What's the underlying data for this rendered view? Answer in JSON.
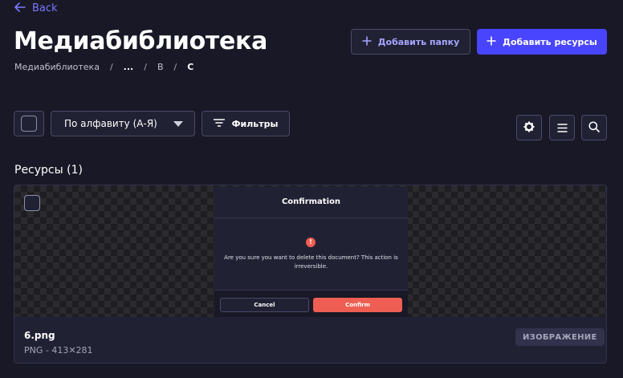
{
  "nav": {
    "back_label": "Back"
  },
  "header": {
    "title": "Медиабиблиотека",
    "add_folder_label": "Добавить папку",
    "add_assets_label": "Добавить ресурсы"
  },
  "breadcrumb": [
    "Медиабиблиотека",
    "...",
    "B",
    "C"
  ],
  "toolbar": {
    "sort_value": "По алфавиту (А-Я)",
    "filters_label": "Фильтры"
  },
  "assets": {
    "section_title": "Ресурсы (1)",
    "items": [
      {
        "name": "6.png",
        "meta": "PNG - 413✕281",
        "type_badge": "ИЗОБРАЖЕНИЕ",
        "preview": {
          "title": "Confirmation",
          "message": "Are you sure you want to delete this document? This action is irreversible.",
          "cancel_label": "Cancel",
          "confirm_label": "Confirm"
        }
      }
    ]
  },
  "colors": {
    "background": "#181826",
    "surface": "#212134",
    "border": "#4a4a6a",
    "primary": "#4945ff",
    "primary_light": "#7b79ff",
    "danger": "#ee5e52",
    "muted_text": "#a5a5ba"
  },
  "icons": [
    "arrow-left-icon",
    "plus-icon",
    "chevron-down-icon",
    "filter-icon",
    "gear-icon",
    "list-view-icon",
    "search-icon",
    "alert-icon"
  ]
}
